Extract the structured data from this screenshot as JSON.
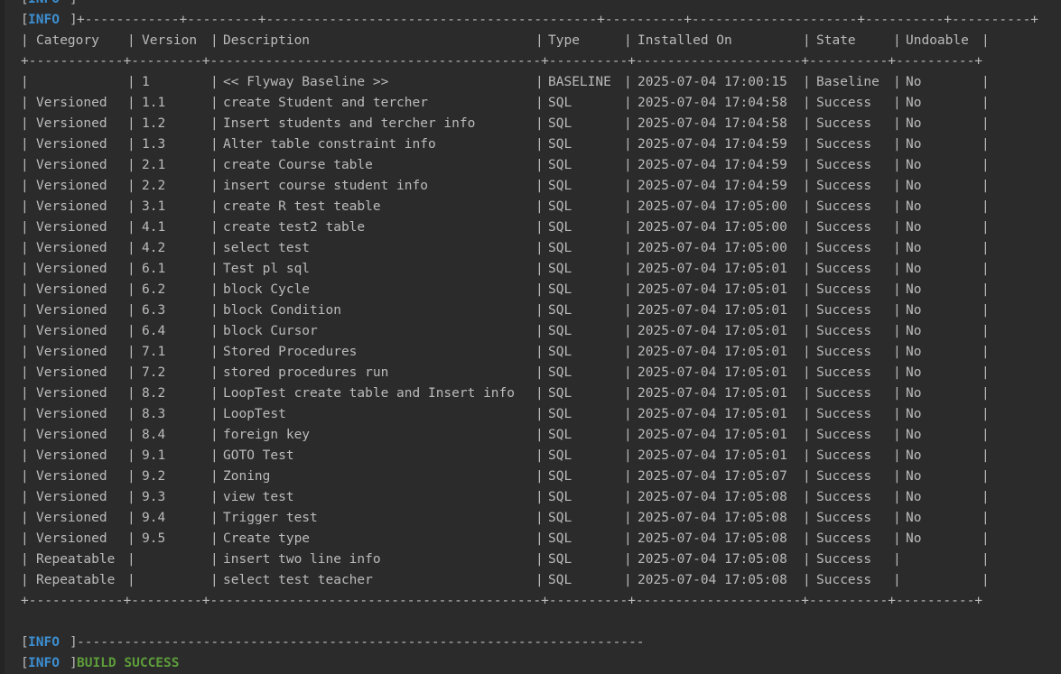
{
  "log_tag": "INFO",
  "table_border_top": "+------------+---------+------------------------------------------+----------+---------------------+----------+----------+",
  "table_border": "+------------+---------+------------------------------------------+----------+---------------------+----------+----------+",
  "columns": [
    "Category",
    "Version",
    "Description",
    "Type",
    "Installed On",
    "State",
    "Undoable"
  ],
  "rows": [
    [
      "",
      "1",
      "<< Flyway Baseline >>",
      "BASELINE",
      "2025-07-04 17:00:15",
      "Baseline",
      "No"
    ],
    [
      "Versioned",
      "1.1",
      "create Student and tercher",
      "SQL",
      "2025-07-04 17:04:58",
      "Success",
      "No"
    ],
    [
      "Versioned",
      "1.2",
      "Insert students and tercher info",
      "SQL",
      "2025-07-04 17:04:58",
      "Success",
      "No"
    ],
    [
      "Versioned",
      "1.3",
      "Alter table constraint info",
      "SQL",
      "2025-07-04 17:04:59",
      "Success",
      "No"
    ],
    [
      "Versioned",
      "2.1",
      "create Course table",
      "SQL",
      "2025-07-04 17:04:59",
      "Success",
      "No"
    ],
    [
      "Versioned",
      "2.2",
      "insert course student info",
      "SQL",
      "2025-07-04 17:04:59",
      "Success",
      "No"
    ],
    [
      "Versioned",
      "3.1",
      "create R test teable",
      "SQL",
      "2025-07-04 17:05:00",
      "Success",
      "No"
    ],
    [
      "Versioned",
      "4.1",
      "create test2 table",
      "SQL",
      "2025-07-04 17:05:00",
      "Success",
      "No"
    ],
    [
      "Versioned",
      "4.2",
      "select test",
      "SQL",
      "2025-07-04 17:05:00",
      "Success",
      "No"
    ],
    [
      "Versioned",
      "6.1",
      "Test pl sql",
      "SQL",
      "2025-07-04 17:05:01",
      "Success",
      "No"
    ],
    [
      "Versioned",
      "6.2",
      "block Cycle",
      "SQL",
      "2025-07-04 17:05:01",
      "Success",
      "No"
    ],
    [
      "Versioned",
      "6.3",
      "block Condition",
      "SQL",
      "2025-07-04 17:05:01",
      "Success",
      "No"
    ],
    [
      "Versioned",
      "6.4",
      "block Cursor",
      "SQL",
      "2025-07-04 17:05:01",
      "Success",
      "No"
    ],
    [
      "Versioned",
      "7.1",
      "Stored Procedures",
      "SQL",
      "2025-07-04 17:05:01",
      "Success",
      "No"
    ],
    [
      "Versioned",
      "7.2",
      "stored procedures run",
      "SQL",
      "2025-07-04 17:05:01",
      "Success",
      "No"
    ],
    [
      "Versioned",
      "8.2",
      "LoopTest create table and Insert info",
      "SQL",
      "2025-07-04 17:05:01",
      "Success",
      "No"
    ],
    [
      "Versioned",
      "8.3",
      "LoopTest",
      "SQL",
      "2025-07-04 17:05:01",
      "Success",
      "No"
    ],
    [
      "Versioned",
      "8.4",
      "foreign key",
      "SQL",
      "2025-07-04 17:05:01",
      "Success",
      "No"
    ],
    [
      "Versioned",
      "9.1",
      "GOTO Test",
      "SQL",
      "2025-07-04 17:05:01",
      "Success",
      "No"
    ],
    [
      "Versioned",
      "9.2",
      "Zoning",
      "SQL",
      "2025-07-04 17:05:07",
      "Success",
      "No"
    ],
    [
      "Versioned",
      "9.3",
      "view test",
      "SQL",
      "2025-07-04 17:05:08",
      "Success",
      "No"
    ],
    [
      "Versioned",
      "9.4",
      "Trigger test",
      "SQL",
      "2025-07-04 17:05:08",
      "Success",
      "No"
    ],
    [
      "Versioned",
      "9.5",
      "Create type",
      "SQL",
      "2025-07-04 17:05:08",
      "Success",
      "No"
    ],
    [
      "Repeatable",
      "",
      "insert two line info",
      "SQL",
      "2025-07-04 17:05:08",
      "Success",
      ""
    ],
    [
      "Repeatable",
      "",
      "select test teacher",
      "SQL",
      "2025-07-04 17:05:08",
      "Success",
      ""
    ]
  ],
  "dash_rule": "------------------------------------------------------------------------",
  "build_result": "BUILD SUCCESS",
  "colors": {
    "background": "#2b2b2b",
    "text": "#bbbbbb",
    "info_tag": "#3d8fd1",
    "success": "#5d9d3a"
  }
}
